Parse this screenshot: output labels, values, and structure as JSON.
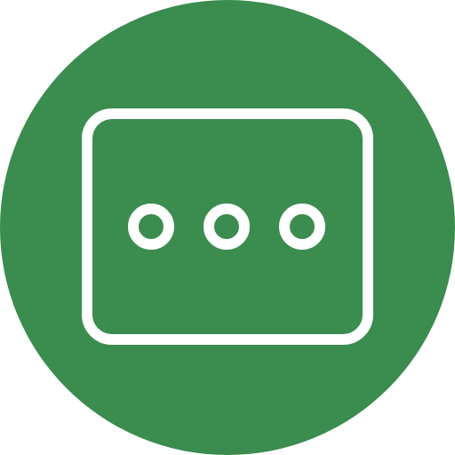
{
  "icon": {
    "semantic": "more-options-icon",
    "colors": {
      "badge_fill": "#3a8c4f",
      "stroke": "#ffffff",
      "background": "#ffffff"
    }
  }
}
